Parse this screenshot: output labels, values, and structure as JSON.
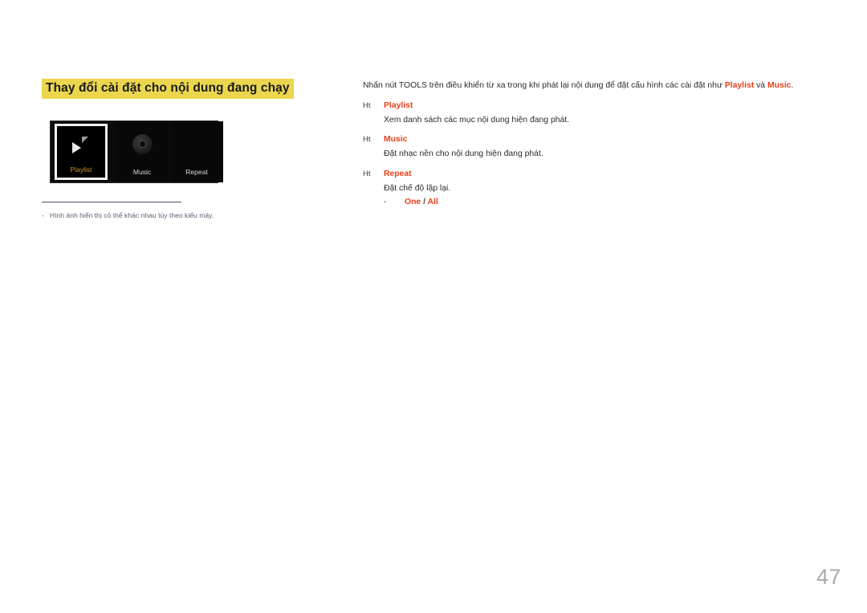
{
  "page": {
    "number": "47"
  },
  "heading": {
    "text": "Thay đổi cài đặt cho nội dung đang chạy",
    "highlight_color": "#ecd64e"
  },
  "figure": {
    "tiles": [
      {
        "label": "Playlist",
        "icon": "play-icon",
        "selected": true,
        "label_color": "#cb9a1f"
      },
      {
        "label": "Music",
        "icon": "disc-icon",
        "selected": false,
        "label_color": "#d8d8d8"
      },
      {
        "label": "Repeat",
        "icon": "none",
        "selected": false,
        "label_color": "#d8d8d8"
      }
    ]
  },
  "footnote": {
    "dash": "-",
    "text": "Hình ảnh hiển thị có thể khác nhau tùy theo kiểu máy."
  },
  "body": {
    "intro": {
      "part1": "Nhấn nút TOOLS trên điều khiển từ xa trong khi phát lại nội dung để đặt cấu hình các cài đặt như ",
      "accent1": "Playlist",
      "part2": " và ",
      "accent2": "Music",
      "part3": "."
    },
    "options": [
      {
        "bullet": "Ht",
        "title": "Playlist",
        "description": "Xem danh sách các mục nội dung hiện đang phát."
      },
      {
        "bullet": "Ht",
        "title": "Music",
        "description": "Đặt nhạc nền cho nội dung hiện đang phát."
      },
      {
        "bullet": "Ht",
        "title": "Repeat",
        "description": "Đặt chế độ lặp lại.",
        "sub": {
          "dash": "-",
          "value_one": "One",
          "separator": " / ",
          "value_all": "All"
        }
      }
    ]
  },
  "colors": {
    "accent_red": "#e8401a",
    "heading_highlight": "#ecd64e",
    "amber_label": "#cb9a1f",
    "footnote_gray": "#5c6073"
  }
}
